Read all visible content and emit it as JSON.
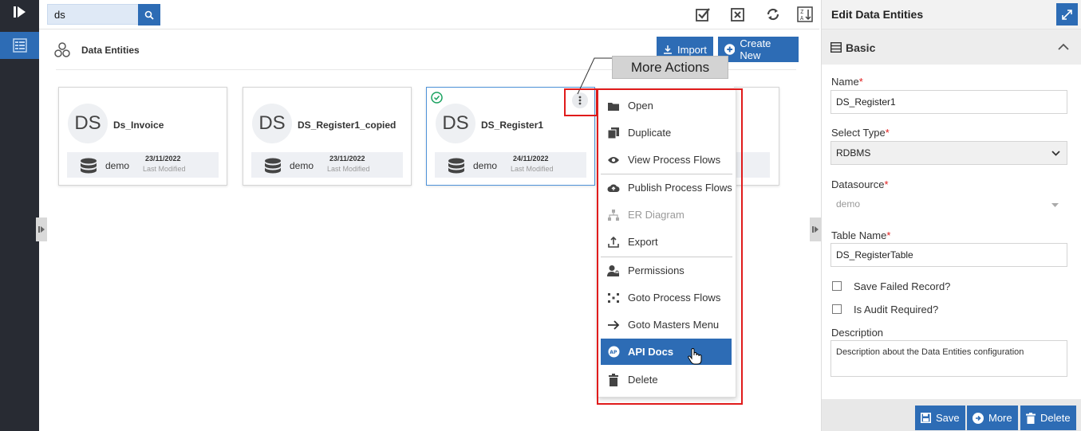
{
  "search": {
    "value": "ds"
  },
  "page": {
    "title": "Data Entities"
  },
  "header_buttons": {
    "import": "Import",
    "create_new": "Create New"
  },
  "cards": [
    {
      "initials": "DS",
      "name": "Ds_Invoice",
      "source": "demo",
      "date": "23/11/2022",
      "modified_label": "Last Modified"
    },
    {
      "initials": "DS",
      "name": "DS_Register1_copied",
      "source": "demo",
      "date": "23/11/2022",
      "modified_label": "Last Modified"
    },
    {
      "initials": "DS",
      "name": "DS_Register1",
      "source": "demo",
      "date": "24/11/2022",
      "modified_label": "Last Modified"
    }
  ],
  "tooltip": "More Actions",
  "menu": {
    "items": [
      {
        "label": "Open",
        "icon": "folder-icon"
      },
      {
        "label": "Duplicate",
        "icon": "copy-icon"
      },
      {
        "label": "View Process Flows",
        "icon": "eye-icon"
      },
      {
        "label": "Publish Process Flows",
        "icon": "cloud-upload-icon"
      },
      {
        "label": "ER Diagram",
        "icon": "sitemap-icon",
        "disabled": true
      },
      {
        "label": "Export",
        "icon": "export-icon"
      },
      {
        "label": "Permissions",
        "icon": "user-lock-icon"
      },
      {
        "label": "Goto Process Flows",
        "icon": "flow-icon"
      },
      {
        "label": "Goto Masters Menu",
        "icon": "arrow-right-icon"
      },
      {
        "label": "API Docs",
        "icon": "api-icon",
        "active": true
      },
      {
        "label": "Delete",
        "icon": "trash-icon"
      }
    ]
  },
  "panel": {
    "title": "Edit Data Entities",
    "section": "Basic",
    "name_label": "Name",
    "name_value": "DS_Register1",
    "type_label": "Select Type",
    "type_value": "RDBMS",
    "datasource_label": "Datasource",
    "datasource_value": "demo",
    "table_label": "Table Name",
    "table_value": "DS_RegisterTable",
    "save_failed_label": "Save Failed Record?",
    "audit_label": "Is Audit Required?",
    "description_label": "Description",
    "description_value": "Description about the Data Entities configuration",
    "required_mark": "*",
    "buttons": {
      "save": "Save",
      "more": "More",
      "delete": "Delete"
    }
  },
  "colors": {
    "accent": "#2d6cb5",
    "rail": "#282b33",
    "highlight": "#e01b1b",
    "check": "#1aa260"
  }
}
